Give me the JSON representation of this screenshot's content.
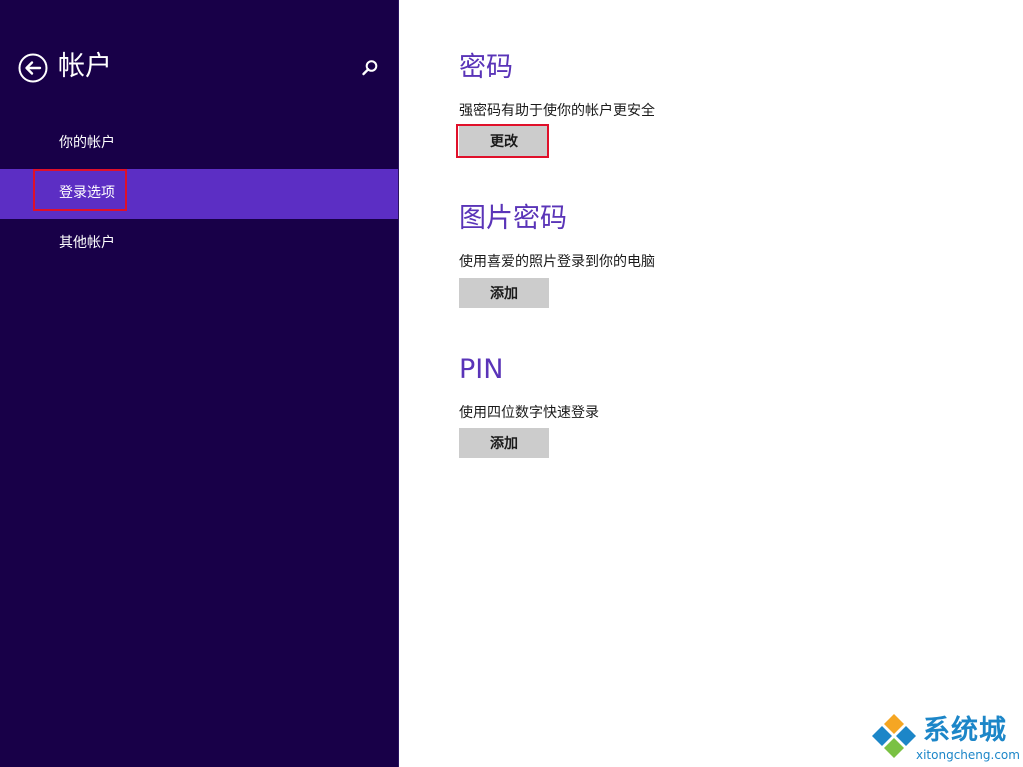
{
  "sidebar": {
    "title": "帐户",
    "back_icon": "back-arrow-icon",
    "search_icon": "search-icon",
    "items": [
      {
        "label": "你的帐户",
        "selected": false
      },
      {
        "label": "登录选项",
        "selected": true
      },
      {
        "label": "其他帐户",
        "selected": false
      }
    ]
  },
  "main": {
    "sections": [
      {
        "title": "密码",
        "description": "强密码有助于使你的帐户更安全",
        "button": "更改"
      },
      {
        "title": "图片密码",
        "description": "使用喜爱的照片登录到你的电脑",
        "button": "添加"
      },
      {
        "title": "PIN",
        "description": "使用四位数字快速登录",
        "button": "添加"
      }
    ]
  },
  "watermark": {
    "brand": "系统城",
    "domain": "xitongcheng.com"
  },
  "colors": {
    "sidebar_bg": "#180048",
    "selected_bg": "#5c2ec4",
    "accent": "#5a34b8",
    "button_bg": "#cccccc",
    "highlight": "#e0102a",
    "watermark": "#1c86c8"
  }
}
